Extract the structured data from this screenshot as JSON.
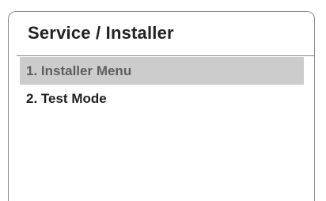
{
  "screen": {
    "title": "Service / Installer"
  },
  "menu": {
    "items": [
      {
        "label": "1. Installer Menu",
        "selected": true
      },
      {
        "label": "2. Test Mode",
        "selected": false
      }
    ]
  },
  "colors": {
    "selected_background": "#cccccc",
    "selected_text": "#5e5e5e",
    "text": "#1e1e1e",
    "border": "#8a8a8a"
  }
}
